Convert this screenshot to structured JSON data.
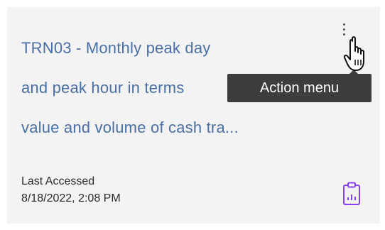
{
  "card": {
    "title_lines": [
      "TRN03 - Monthly peak day",
      "and peak hour in terms",
      "value and volume of cash tra..."
    ],
    "last_accessed_label": "Last Accessed",
    "last_accessed_value": "8/18/2022, 2:08 PM",
    "report_icon": "report-clipboard-icon"
  },
  "overflow_menu": {
    "icon": "overflow-menu-vertical-icon",
    "tooltip": "Action menu"
  },
  "colors": {
    "card_background": "#f3f3f3",
    "title_link": "#4a6fa5",
    "tooltip_background": "#3d3d3d",
    "report_icon": "#8a3ffc"
  }
}
